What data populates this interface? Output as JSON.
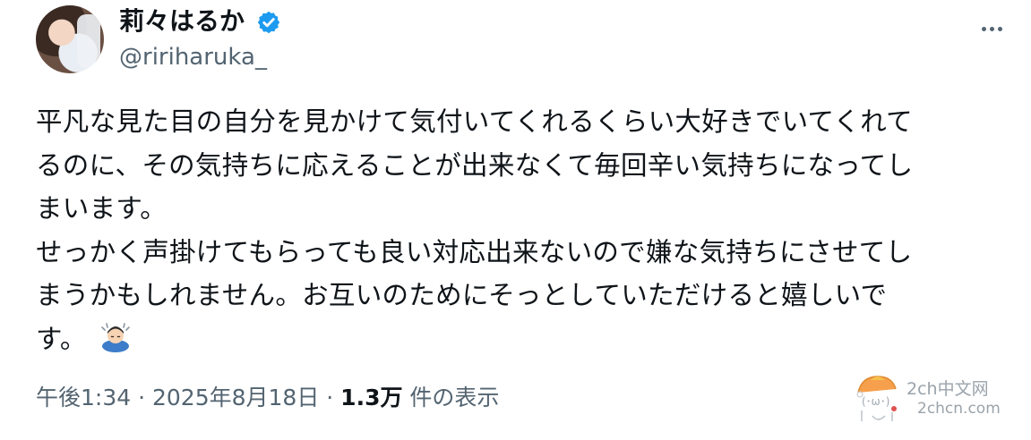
{
  "user": {
    "display_name": "莉々はるか",
    "handle": "@ririharuka_"
  },
  "post": {
    "lines": [
      "平凡な見た目の自分を見かけて気付いてくれるくらい大好きでいてくれて",
      "るのに、その気持ちに応えることが出来なくて毎回辛い気持ちになってし",
      "まいます。",
      "せっかく声掛けてもらっても良い対応出来ないので嫌な気持ちにさせてし",
      "まうかもしれません。お互いのためにそっとしていただけると嬉しいで",
      "す。"
    ],
    "emoji": "person-bowing-emoji"
  },
  "meta": {
    "time": "午後1:34",
    "sep1": " · ",
    "date": "2025年8月18日",
    "sep2": " · ",
    "views_count": "1.3万",
    "views_label": " 件の表示"
  },
  "watermark": {
    "title": "2ch中文网",
    "domain": "2chcn.com"
  },
  "colors": {
    "text": "#0f1419",
    "secondary": "#536471",
    "verified": "#1d9bf0"
  }
}
